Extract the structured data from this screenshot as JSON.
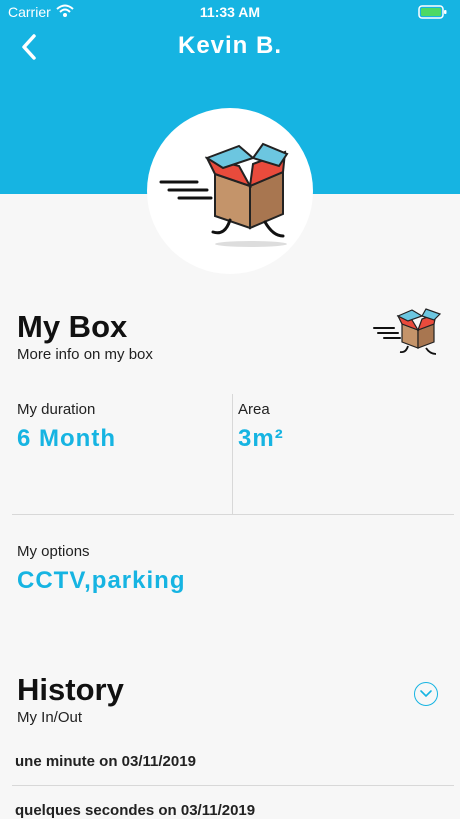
{
  "status": {
    "carrier": "Carrier",
    "time": "11:33 AM"
  },
  "header": {
    "title": "Kevin B."
  },
  "box": {
    "title": "My Box",
    "subtitle": "More info on my box"
  },
  "duration": {
    "label": "My duration",
    "value": "6 Month"
  },
  "area": {
    "label": "Area",
    "value": "3m²"
  },
  "options": {
    "label": "My options",
    "value": "CCTV,parking"
  },
  "history": {
    "title": "History",
    "subtitle": "My In/Out",
    "rows": [
      "une minute on 03/11/2019",
      "quelques secondes on 03/11/2019"
    ]
  },
  "colors": {
    "accent": "#16b4e2",
    "background": "#f7f7f7"
  },
  "icons": [
    "wifi-icon",
    "battery-icon",
    "back-arrow-icon",
    "running-box-icon",
    "chevron-down-icon"
  ]
}
